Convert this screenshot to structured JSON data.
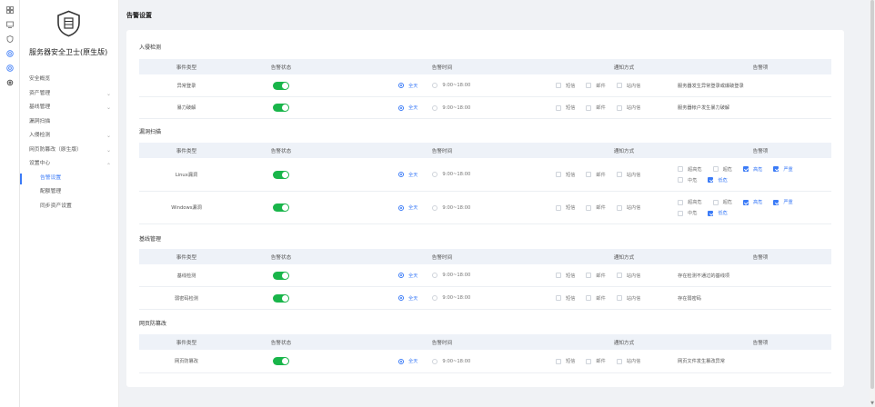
{
  "app": {
    "title": "服务器安全卫士(原生版)"
  },
  "rail": {
    "icons": [
      "grid-icon",
      "monitor-icon",
      "shield-icon",
      "circle-icon",
      "circle-icon",
      "gear-icon"
    ]
  },
  "sidebar": {
    "items": [
      {
        "label": "安全概览",
        "chev": ""
      },
      {
        "label": "资产管理",
        "chev": "⌄"
      },
      {
        "label": "基线管理",
        "chev": "⌄"
      },
      {
        "label": "漏洞扫描",
        "chev": ""
      },
      {
        "label": "入侵检测",
        "chev": "⌄"
      },
      {
        "label": "网页防篡改（原生版）",
        "chev": "⌄"
      },
      {
        "label": "设置中心",
        "chev": "⌄"
      },
      {
        "label": "告警设置",
        "chev": ""
      },
      {
        "label": "配额管理",
        "chev": ""
      },
      {
        "label": "同步资产设置",
        "chev": ""
      }
    ]
  },
  "page": {
    "title": "告警设置"
  },
  "table_headers": {
    "type": "事件类型",
    "status": "告警状态",
    "time": "告警时间",
    "notify": "通知方式",
    "item": "告警项"
  },
  "time_options": {
    "allday": "全天",
    "range": "9:00~18:00"
  },
  "notify_options": {
    "sms": "短信",
    "email": "邮件",
    "inbox": "站内信"
  },
  "levels": {
    "l1": "超高危",
    "l2": "超危",
    "l3": "高危",
    "l4": "严重",
    "l5": "中危",
    "l6": "低危"
  },
  "sections": {
    "intrusion": {
      "title": "入侵检测",
      "rows": [
        {
          "type": "异常登录",
          "item": "服务器发生异常登录或爆破登录"
        },
        {
          "type": "暴力破解",
          "item": "服务器帐户发生暴力破解"
        }
      ]
    },
    "vuln": {
      "title": "漏洞扫描",
      "rows": [
        {
          "type": "Linux漏洞"
        },
        {
          "type": "Windows漏洞"
        }
      ]
    },
    "baseline": {
      "title": "基线管理",
      "rows": [
        {
          "type": "基线检测",
          "item": "存在检测不通过的基线项"
        },
        {
          "type": "弱密码检测",
          "item": "存在弱密码"
        }
      ]
    },
    "tamper": {
      "title": "网页防篡改",
      "rows": [
        {
          "type": "网页防篡改",
          "item": "网页文件发生篡改异常"
        }
      ]
    }
  }
}
